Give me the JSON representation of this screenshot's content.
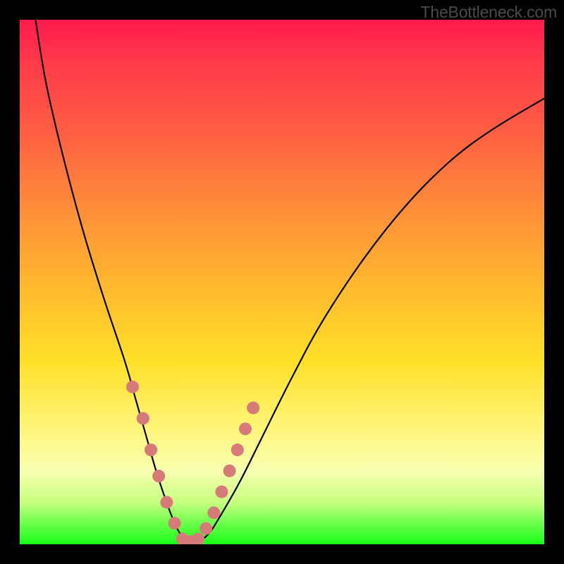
{
  "watermark": "TheBottleneck.com",
  "chart_data": {
    "type": "line",
    "title": "",
    "xlabel": "",
    "ylabel": "",
    "xlim": [
      0,
      100
    ],
    "ylim": [
      0,
      100
    ],
    "series": [
      {
        "name": "bottleneck-curve",
        "x": [
          3,
          5,
          8,
          12,
          16,
          20,
          22,
          24,
          26,
          28,
          30,
          32,
          34,
          36,
          38,
          42,
          46,
          52,
          58,
          66,
          74,
          82,
          90,
          100
        ],
        "values": [
          100,
          88,
          75,
          60,
          47,
          35,
          28,
          21,
          14,
          8,
          3,
          0.5,
          0.5,
          2,
          5,
          12,
          20,
          32,
          43,
          55,
          65,
          73,
          79,
          85
        ]
      }
    ],
    "markers": {
      "name": "highlighted-points",
      "color": "#d77a7a",
      "x": [
        21.5,
        23.5,
        25,
        26.5,
        28,
        29.5,
        31,
        32.5,
        34,
        35.5,
        37,
        38.5,
        40,
        41.5,
        43,
        44.5
      ],
      "values": [
        30,
        24,
        18,
        13,
        8,
        4,
        1,
        0.5,
        1,
        3,
        6,
        10,
        14,
        18,
        22,
        26
      ]
    },
    "background_gradient": {
      "stops": [
        {
          "pos": 0.0,
          "color": "#ff1a4d"
        },
        {
          "pos": 0.5,
          "color": "#ffb62f"
        },
        {
          "pos": 0.78,
          "color": "#fff57a"
        },
        {
          "pos": 1.0,
          "color": "#18ff18"
        }
      ]
    }
  }
}
